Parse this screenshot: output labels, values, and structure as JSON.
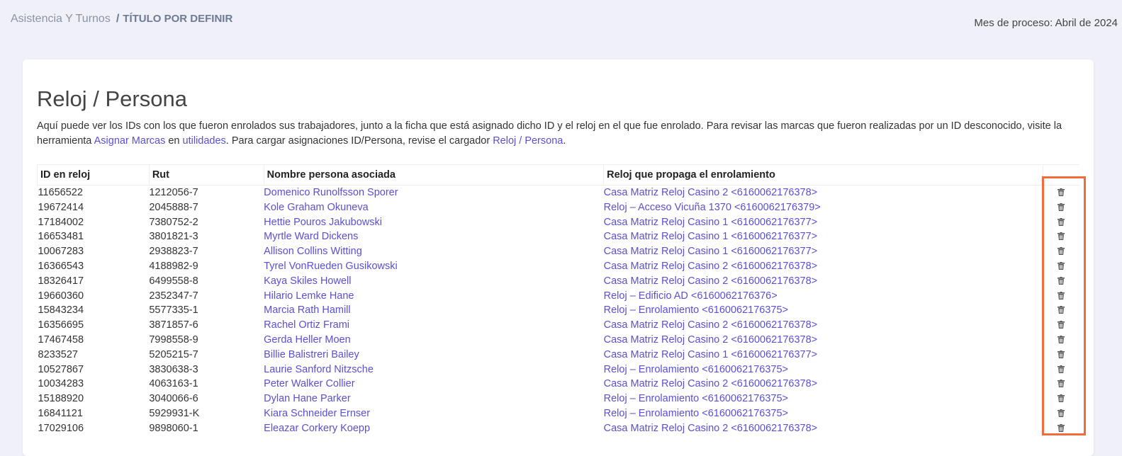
{
  "breadcrumb": {
    "parent": "Asistencia Y Turnos",
    "separator": "/",
    "current": "TÍTULO POR DEFINIR"
  },
  "header": {
    "mes_proceso": "Mes de proceso: Abril de 2024"
  },
  "page": {
    "title": "Reloj / Persona",
    "desc_1": "Aquí puede ver los IDs con los que fueron enrolados sus trabajadores, junto a la ficha que está asignado dicho ID y el reloj en el que fue enrolado. Para revisar las marcas que fueron realizadas por un ID desconocido, visite la herramienta ",
    "link_asignar": "Asignar Marcas",
    "desc_2": " en ",
    "link_utilidades": "utilidades",
    "desc_3": ". Para cargar asignaciones ID/Persona, revise el cargador ",
    "link_reloj_persona": "Reloj / Persona",
    "desc_4": "."
  },
  "table": {
    "headers": [
      "ID en reloj",
      "Rut",
      "Nombre persona asociada",
      "Reloj que propaga el enrolamiento",
      ""
    ],
    "rows": [
      {
        "id": "11656522",
        "rut": "1212056-7",
        "name": "Domenico Runolfsson Sporer",
        "reloj": "Casa Matriz Reloj Casino 2 <6160062176378>"
      },
      {
        "id": "19672414",
        "rut": "2045888-7",
        "name": "Kole Graham Okuneva",
        "reloj": "Reloj – Acceso Vicuña 1370 <6160062176379>"
      },
      {
        "id": "17184002",
        "rut": "7380752-2",
        "name": "Hettie Pouros Jakubowski",
        "reloj": "Casa Matriz Reloj Casino 1 <6160062176377>"
      },
      {
        "id": "16653481",
        "rut": "3801821-3",
        "name": "Myrtle Ward Dickens",
        "reloj": "Casa Matriz Reloj Casino 1 <6160062176377>"
      },
      {
        "id": "10067283",
        "rut": "2938823-7",
        "name": "Allison Collins Witting",
        "reloj": "Casa Matriz Reloj Casino 1 <6160062176377>"
      },
      {
        "id": "16366543",
        "rut": "4188982-9",
        "name": "Tyrel VonRueden Gusikowski",
        "reloj": "Casa Matriz Reloj Casino 2 <6160062176378>"
      },
      {
        "id": "18326417",
        "rut": "6499558-8",
        "name": "Kaya Skiles Howell",
        "reloj": "Casa Matriz Reloj Casino 2 <6160062176378>"
      },
      {
        "id": "19660360",
        "rut": "2352347-7",
        "name": "Hilario Lemke Hane",
        "reloj": "Reloj – Edificio AD <6160062176376>"
      },
      {
        "id": "15843234",
        "rut": "5577335-1",
        "name": "Marcia Rath Hamill",
        "reloj": "Reloj – Enrolamiento <6160062176375>"
      },
      {
        "id": "16356695",
        "rut": "3871857-6",
        "name": "Rachel Ortiz Frami",
        "reloj": "Casa Matriz Reloj Casino 2 <6160062176378>"
      },
      {
        "id": "17467458",
        "rut": "7998558-9",
        "name": "Gerda Heller Moen",
        "reloj": "Casa Matriz Reloj Casino 2 <6160062176378>"
      },
      {
        "id": "8233527",
        "rut": "5205215-7",
        "name": "Billie Balistreri Bailey",
        "reloj": "Casa Matriz Reloj Casino 1 <6160062176377>"
      },
      {
        "id": "10527867",
        "rut": "3830638-3",
        "name": "Laurie Sanford Nitzsche",
        "reloj": "Reloj – Enrolamiento <6160062176375>"
      },
      {
        "id": "10034283",
        "rut": "4063163-1",
        "name": "Peter Walker Collier",
        "reloj": "Casa Matriz Reloj Casino 2 <6160062176378>"
      },
      {
        "id": "15188920",
        "rut": "3040066-6",
        "name": "Dylan Hane Parker",
        "reloj": "Reloj – Enrolamiento <6160062176375>"
      },
      {
        "id": "16841121",
        "rut": "5929931-K",
        "name": "Kiara Schneider Ernser",
        "reloj": "Reloj – Enrolamiento <6160062176375>"
      },
      {
        "id": "17029106",
        "rut": "9898060-1",
        "name": "Eleazar Corkery Koepp",
        "reloj": "Casa Matriz Reloj Casino 2 <6160062176378>"
      }
    ],
    "row_action_icon": "trash-icon"
  },
  "colors": {
    "link": "#5a4fd6",
    "highlight": "#f26a3d",
    "background": "#f0f0f8"
  }
}
